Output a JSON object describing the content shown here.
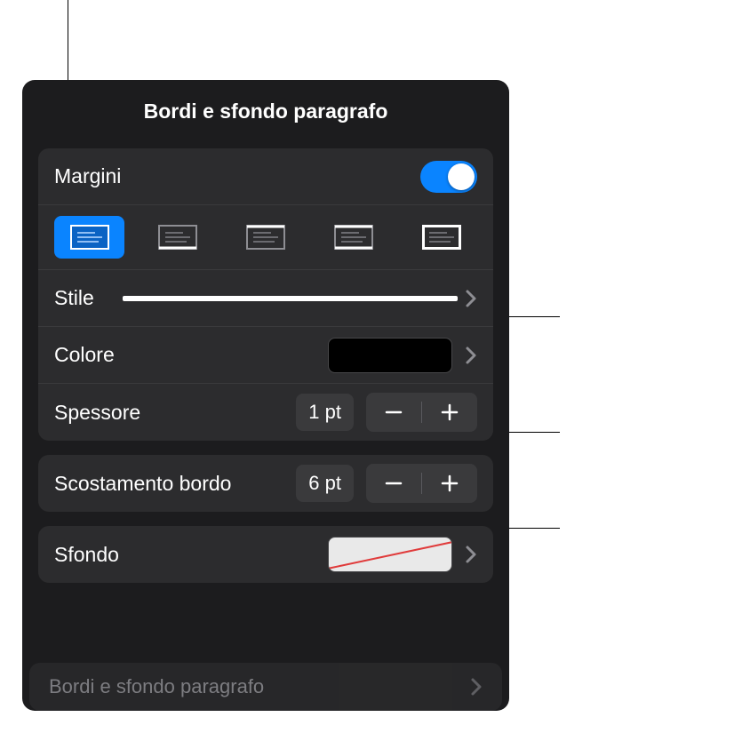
{
  "title": "Bordi e sfondo paragrafo",
  "margins": {
    "label": "Margini",
    "enabled": true
  },
  "border_positions": {
    "selected_index": 0,
    "items": [
      "no-border",
      "border-bottom",
      "border-top",
      "border-left-right",
      "border-all"
    ]
  },
  "style": {
    "label": "Stile"
  },
  "color": {
    "label": "Colore",
    "value": "#000000"
  },
  "thickness": {
    "label": "Spessore",
    "value": "1 pt"
  },
  "offset": {
    "label": "Scostamento bordo",
    "value": "6 pt"
  },
  "background": {
    "label": "Sfondo",
    "value": "none"
  },
  "back_link": {
    "label": "Bordi e sfondo paragrafo"
  },
  "colors": {
    "accent": "#0a84ff"
  }
}
